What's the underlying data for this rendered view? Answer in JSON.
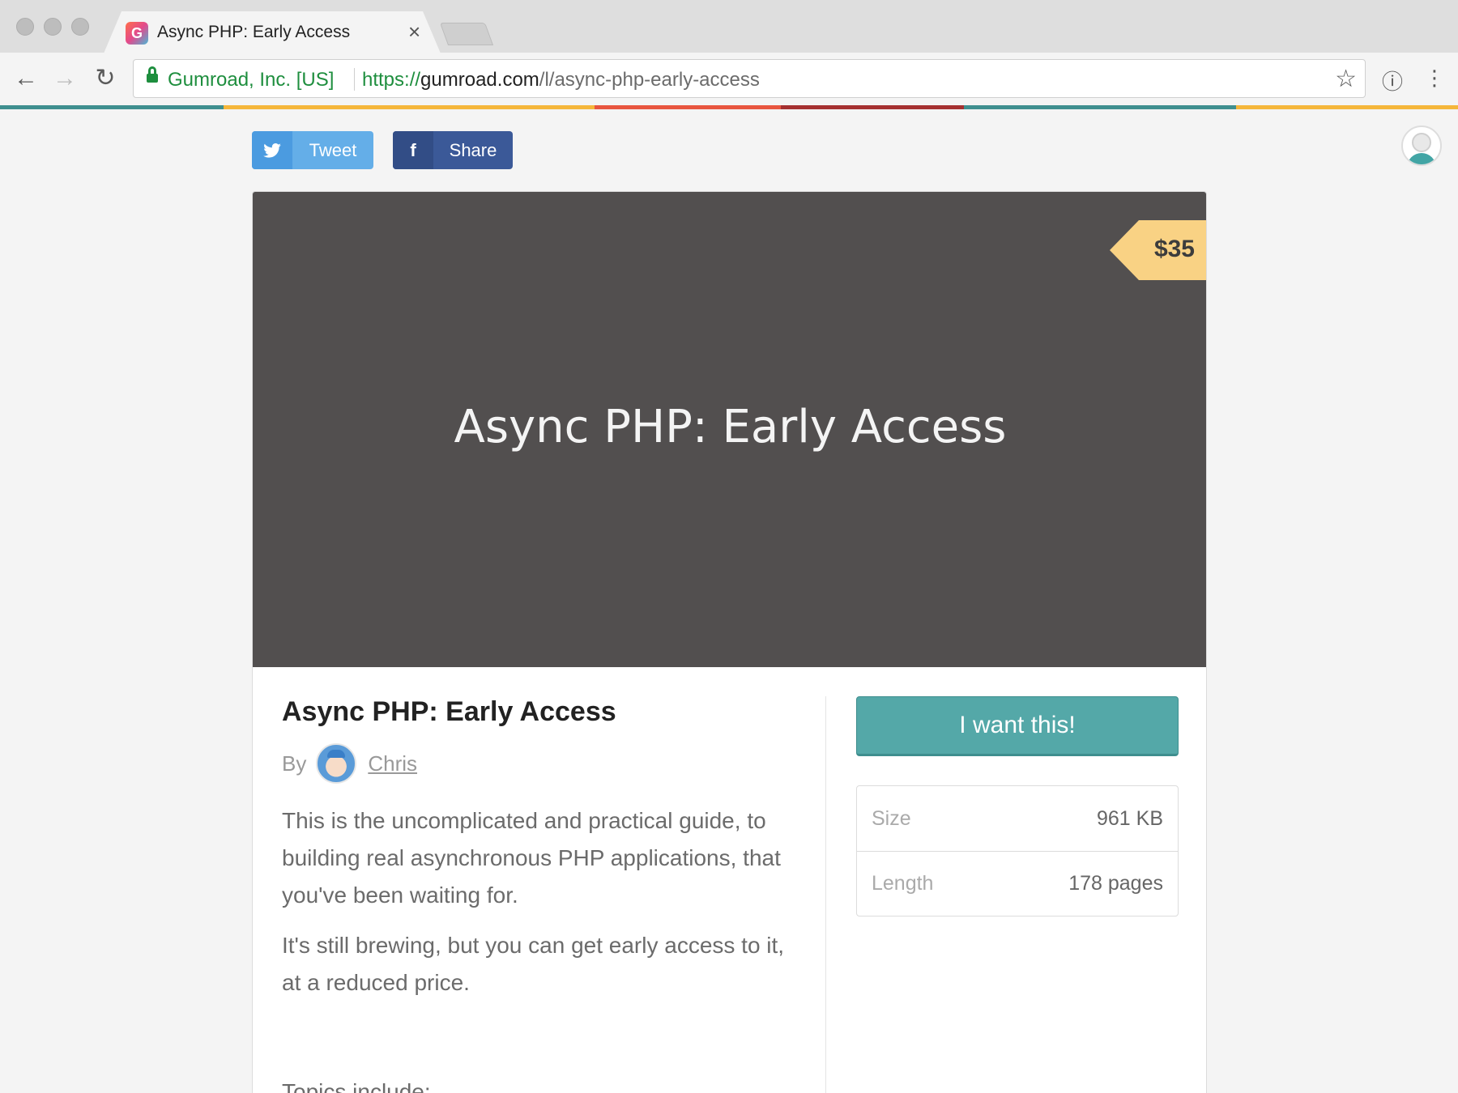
{
  "browser": {
    "tab_title": "Async PHP: Early Access",
    "tab_close": "×",
    "favicon_letter": "G",
    "cert_name": "Gumroad, Inc. [US]",
    "url_scheme": "https://",
    "url_host": "gumroad.com",
    "url_path": "/l/async-php-early-access",
    "back_icon": "←",
    "forward_icon": "→",
    "reload_icon": "↻",
    "star_icon": "☆",
    "extension_icon": "ⓘ",
    "menu_icon": "⋮"
  },
  "stripe_colors": [
    "#3f8f8f",
    "#f5b63a",
    "#e8553f",
    "#a53030",
    "#3f8f8f",
    "#f5b63a"
  ],
  "social": {
    "tweet_icon": "🐦",
    "tweet_label": "Tweet",
    "facebook_icon": "f",
    "share_label": "Share"
  },
  "product": {
    "cover_title": "Async PHP: Early Access",
    "price": "$35",
    "title": "Async PHP: Early Access",
    "by_label": "By",
    "creator": "Chris",
    "description": [
      "This is the uncomplicated and practical guide, to building real asynchronous PHP applications, that you've been waiting for.",
      "It's still brewing, but you can get early access to it, at a reduced price."
    ],
    "topics_heading": "Topics include:",
    "cta_label": "I want this!",
    "details": [
      {
        "key": "Size",
        "value": "961 KB"
      },
      {
        "key": "Length",
        "value": "178 pages"
      }
    ]
  }
}
